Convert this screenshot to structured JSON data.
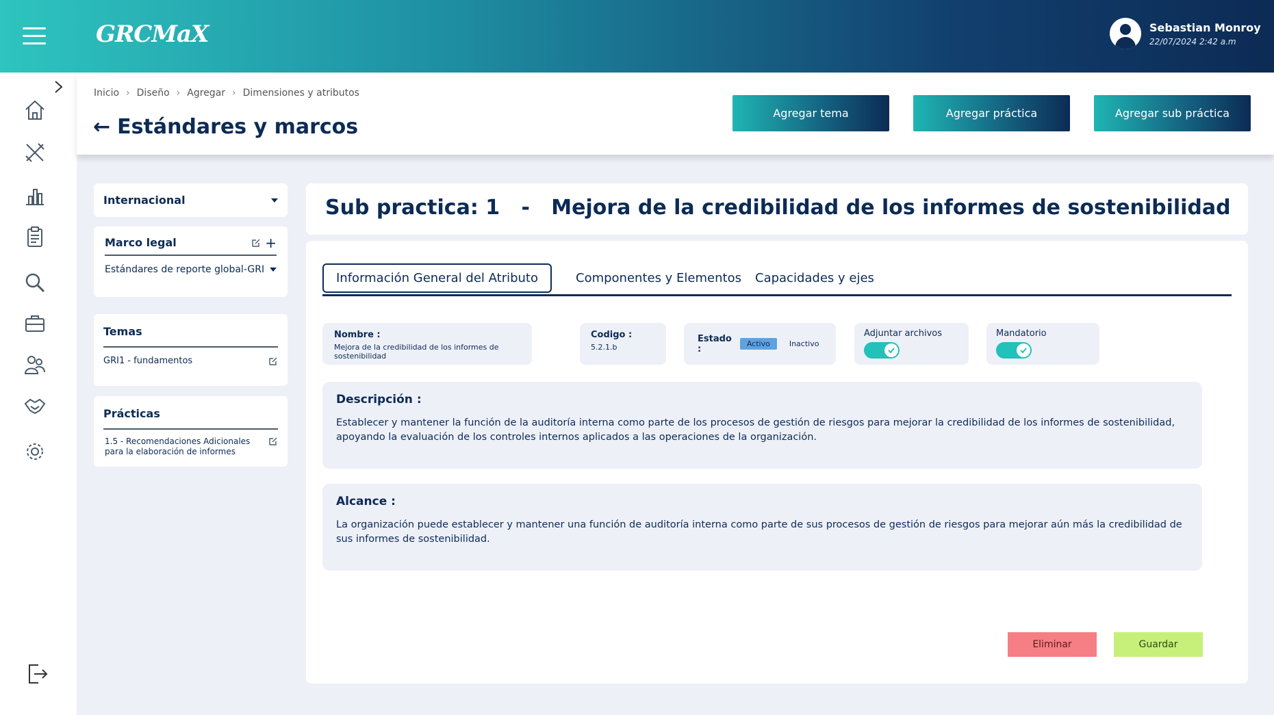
{
  "header": {
    "logo_text": "GRCMaX",
    "user_name": "Sebastian Monroy",
    "user_datetime": "22/07/2024  2:42 a.m"
  },
  "sidebar": {
    "items": [
      {
        "icon": "home-icon"
      },
      {
        "icon": "design-tools-icon"
      },
      {
        "icon": "bar-chart-icon"
      },
      {
        "icon": "clipboard-icon"
      },
      {
        "icon": "search-icon"
      },
      {
        "icon": "briefcase-icon"
      },
      {
        "icon": "users-icon"
      },
      {
        "icon": "handshake-icon"
      },
      {
        "icon": "gear-icon"
      }
    ],
    "logout_icon": "logout-icon"
  },
  "breadcrumb": [
    "Inicio",
    "Diseño",
    "Agregar",
    "Dimensiones y atributos"
  ],
  "page_title": "Estándares y marcos",
  "actions": {
    "add_topic": "Agregar tema",
    "add_practice": "Agregar práctica",
    "add_sub_practice": "Agregar sub práctica"
  },
  "filters": {
    "scope": "Internacional",
    "legal_framework": {
      "title": "Marco legal",
      "selected": "Estándares de reporte global-GRI"
    },
    "topics": {
      "title": "Temas",
      "item": "GRI1 - fundamentos"
    },
    "practices": {
      "title": "Prácticas",
      "item": "1.5  -  Recomendaciones Adicionales para la elaboración de informes"
    }
  },
  "subpractice": {
    "title": "Sub practica: 1   -   Mejora de la credibilidad de los informes de sostenibilidad"
  },
  "tabs": [
    "Información General del Atributo",
    "Componentes y Elementos",
    "Capacidades y ejes"
  ],
  "fields": {
    "name_label": "Nombre :",
    "name_value": "Mejora de la credibilidad de los informes de sostenibilidad",
    "code_label": "Codigo :",
    "code_value": "5.2.1.b",
    "status_label": "Estado :",
    "status_active": "Activo",
    "status_inactive": "Inactivo",
    "attach_label": "Adjuntar archivos",
    "attach_on": true,
    "mandatory_label": "Mandatorio",
    "mandatory_on": true
  },
  "description": {
    "title": "Descripción :",
    "text": "Establecer y mantener la función de la auditoría interna como parte de los procesos de gestión de riesgos para mejorar la credibilidad de los informes de sostenibilidad, apoyando la evaluación de los controles internos aplicados a las operaciones de la organización."
  },
  "scope": {
    "title": "Alcance :",
    "text": "La organización puede establecer y mantener una función de auditoría interna como parte de sus procesos de gestión de riesgos para mejorar aún más la credibilidad de sus informes de sostenibilidad."
  },
  "buttons": {
    "delete": "Eliminar",
    "save": "Guardar"
  },
  "colors": {
    "brand_dark": "#0c2b55",
    "brand_teal": "#22c1ba",
    "delete": "#f57f85",
    "save": "#c6f07a"
  }
}
